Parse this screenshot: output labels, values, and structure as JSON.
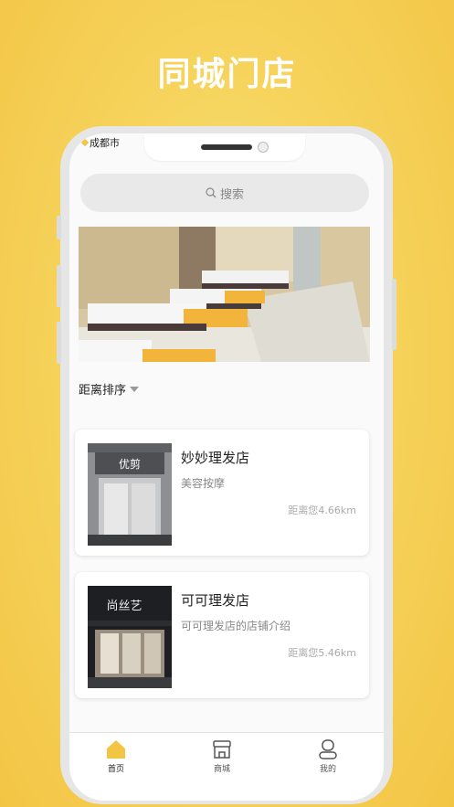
{
  "hero": {
    "title": "同城门店"
  },
  "status": {
    "city": "成都市"
  },
  "search": {
    "placeholder": "搜索"
  },
  "sort": {
    "label": "距离排序"
  },
  "stores": [
    {
      "name": "妙妙理发店",
      "desc": "美容按摩",
      "distance": "距离您4.66km",
      "sign": "优剪"
    },
    {
      "name": "可可理发店",
      "desc": "可可理发店的店铺介绍",
      "distance": "距离您5.46km",
      "sign": "尚丝艺"
    }
  ],
  "tabbar": [
    {
      "label": "首页",
      "icon": "home-icon",
      "active": true
    },
    {
      "label": "商城",
      "icon": "store-icon",
      "active": false
    },
    {
      "label": "我的",
      "icon": "user-icon",
      "active": false
    }
  ],
  "colors": {
    "accent": "#f3c545",
    "background": "#f6d45d"
  }
}
